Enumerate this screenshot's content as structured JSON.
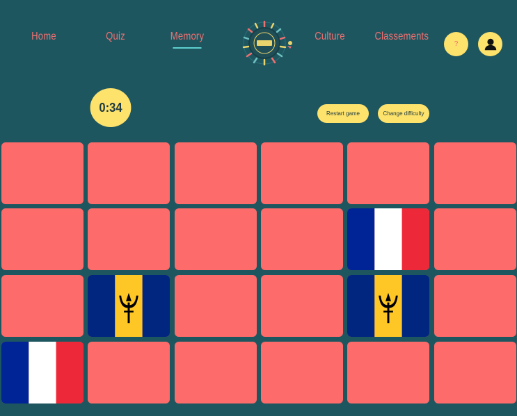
{
  "nav": {
    "home": "Home",
    "quiz": "Quiz",
    "memory": "Memory",
    "culture": "Culture",
    "classements": "Classements"
  },
  "header": {
    "help_label": "?",
    "user_icon": "user-icon",
    "logo_icon": "world-travel-logo"
  },
  "game": {
    "timer": "0:34",
    "restart_label": "Restart game",
    "difficulty_label": "Change difficulty"
  },
  "colors": {
    "background": "#1e5660",
    "card_back": "#fd6b6a",
    "accent_yellow": "#fde26c",
    "nav_text": "#f07070",
    "active_underline": "#5fd0d0"
  },
  "board": {
    "columns": 6,
    "rows": 4,
    "cards": [
      "back",
      "back",
      "back",
      "back",
      "back",
      "back",
      "back",
      "back",
      "back",
      "back",
      "france",
      "back",
      "back",
      "barbados",
      "back",
      "back",
      "barbados",
      "back",
      "france",
      "back",
      "back",
      "back",
      "back",
      "back"
    ]
  }
}
